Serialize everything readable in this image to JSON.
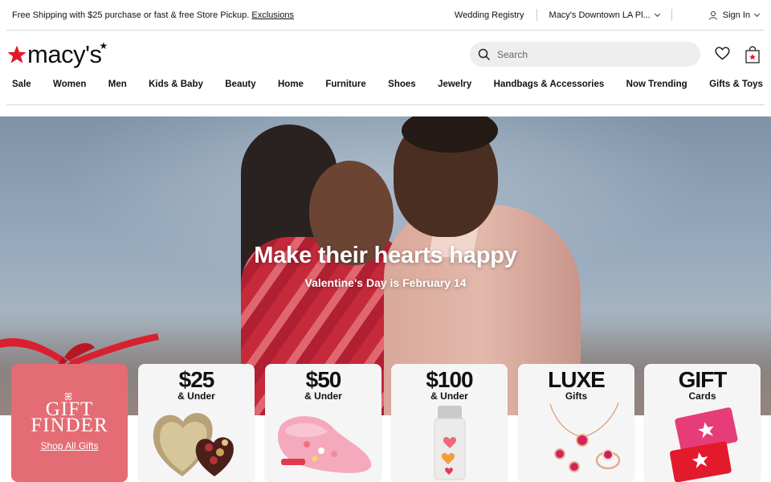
{
  "utility": {
    "promo": "Free Shipping with $25 purchase or fast & free Store Pickup.",
    "exclusions": "Exclusions",
    "registry": "Wedding Registry",
    "store": "Macy's Downtown LA Pl...",
    "signin": "Sign In"
  },
  "header": {
    "logo": "macy's",
    "search_placeholder": "Search"
  },
  "nav": [
    "Sale",
    "Women",
    "Men",
    "Kids & Baby",
    "Beauty",
    "Home",
    "Furniture",
    "Shoes",
    "Jewelry",
    "Handbags & Accessories",
    "Now Trending",
    "Gifts & Toys"
  ],
  "hero": {
    "title": "Make their hearts happy",
    "subtitle": "Valentine's Day is February 14"
  },
  "gift_finder": {
    "line1": "GIFT",
    "line2": "FINDER",
    "link": "Shop All Gifts"
  },
  "cards": [
    {
      "big": "$25",
      "small": "& Under"
    },
    {
      "big": "$50",
      "small": "& Under"
    },
    {
      "big": "$100",
      "small": "& Under"
    },
    {
      "big": "LUXE",
      "small": "Gifts"
    },
    {
      "big": "GIFT",
      "small": "Cards"
    }
  ],
  "colors": {
    "brand_red": "#e21a2c",
    "gift_finder_bg": "#e46c74"
  }
}
